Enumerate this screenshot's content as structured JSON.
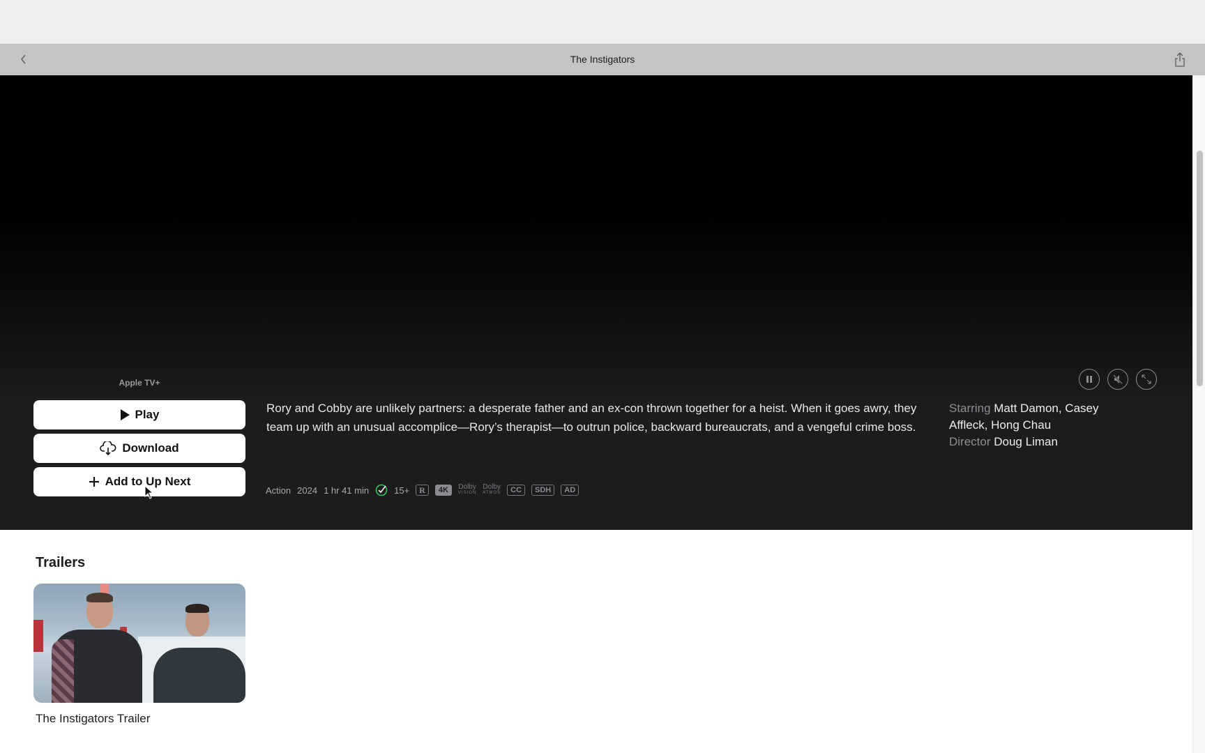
{
  "window": {
    "title": "The Instigators",
    "back_icon": "chevron-left-icon",
    "share_icon": "share-icon"
  },
  "hero": {
    "provider": "Apple TV+",
    "buttons": {
      "play": "Play",
      "download": "Download",
      "add_up_next": "Add to Up Next"
    },
    "description": "Rory and Cobby are unlikely partners: a desperate father and an ex-con thrown together for a heist. When it goes awry, they team up with an unusual accomplice—Rory’s therapist—to outrun police, backward bureaucrats, and a vengeful crime boss.",
    "meta": {
      "genre": "Action",
      "year": "2024",
      "duration": "1 hr 41 min",
      "age_rating": "15+",
      "badges": {
        "rating": "R",
        "resolution": "4K",
        "dolby_vision_top": "Dolby",
        "dolby_vision_bottom": "VISION",
        "dolby_atmos_top": "Dolby",
        "dolby_atmos_bottom": "ATMOS",
        "cc": "CC",
        "sdh": "SDH",
        "ad": "AD"
      }
    },
    "credits": {
      "starring_label": "Starring",
      "starring": "Matt Damon, Casey Affleck, Hong Chau",
      "director_label": "Director",
      "director": "Doug Liman"
    },
    "controls": [
      "pause",
      "mute",
      "fullscreen"
    ]
  },
  "trailers": {
    "heading": "Trailers",
    "items": [
      {
        "title": "The Instigators Trailer"
      }
    ]
  },
  "colors": {
    "hero_bg": "#1c1c1e",
    "toolbar_bg": "#c4c4c4",
    "check_green": "#34c759"
  }
}
